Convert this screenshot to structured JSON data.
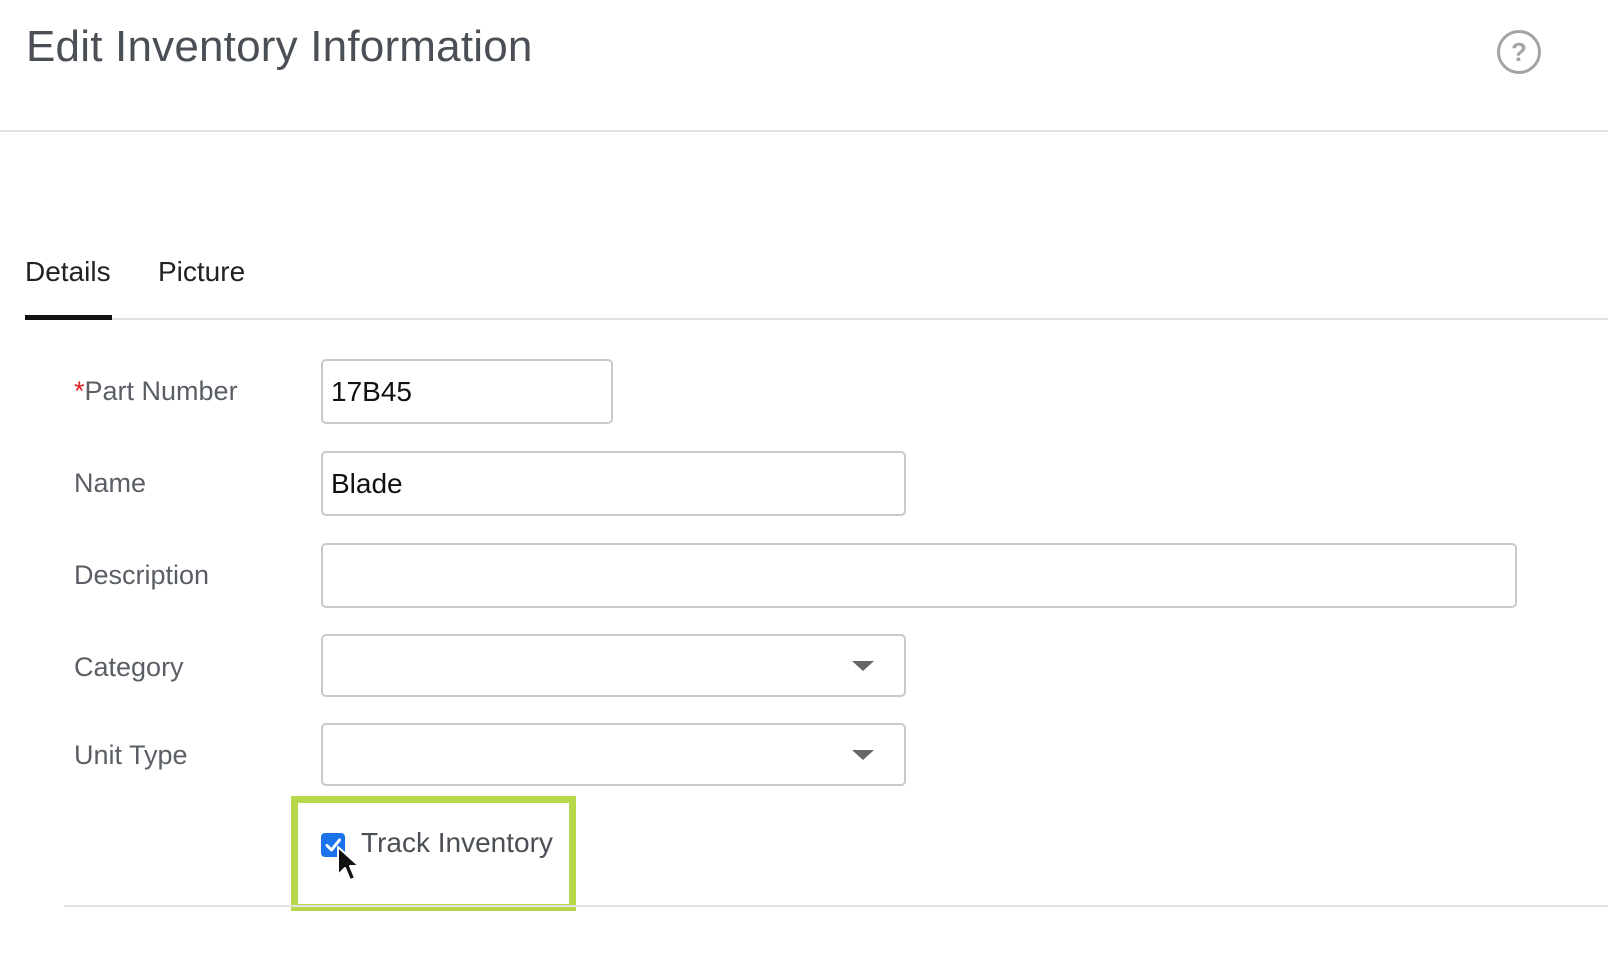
{
  "header": {
    "title": "Edit Inventory Information",
    "help_glyph": "?"
  },
  "tabs": [
    {
      "label": "Details",
      "active": true
    },
    {
      "label": "Picture",
      "active": false
    }
  ],
  "form": {
    "part_number": {
      "required_mark": "*",
      "label": "Part Number",
      "value": "17B45"
    },
    "name": {
      "label": "Name",
      "value": "Blade"
    },
    "description": {
      "label": "Description",
      "value": ""
    },
    "category": {
      "label": "Category",
      "value": ""
    },
    "unit_type": {
      "label": "Unit Type",
      "value": ""
    },
    "track_inventory": {
      "label": "Track Inventory",
      "checked": true
    }
  },
  "colors": {
    "accent": "#1a73e8",
    "highlight": "#b6d84a",
    "required": "#e02020"
  },
  "icons": [
    "help-icon",
    "chevron-down-icon",
    "checkmark-icon",
    "mouse-cursor-icon"
  ]
}
